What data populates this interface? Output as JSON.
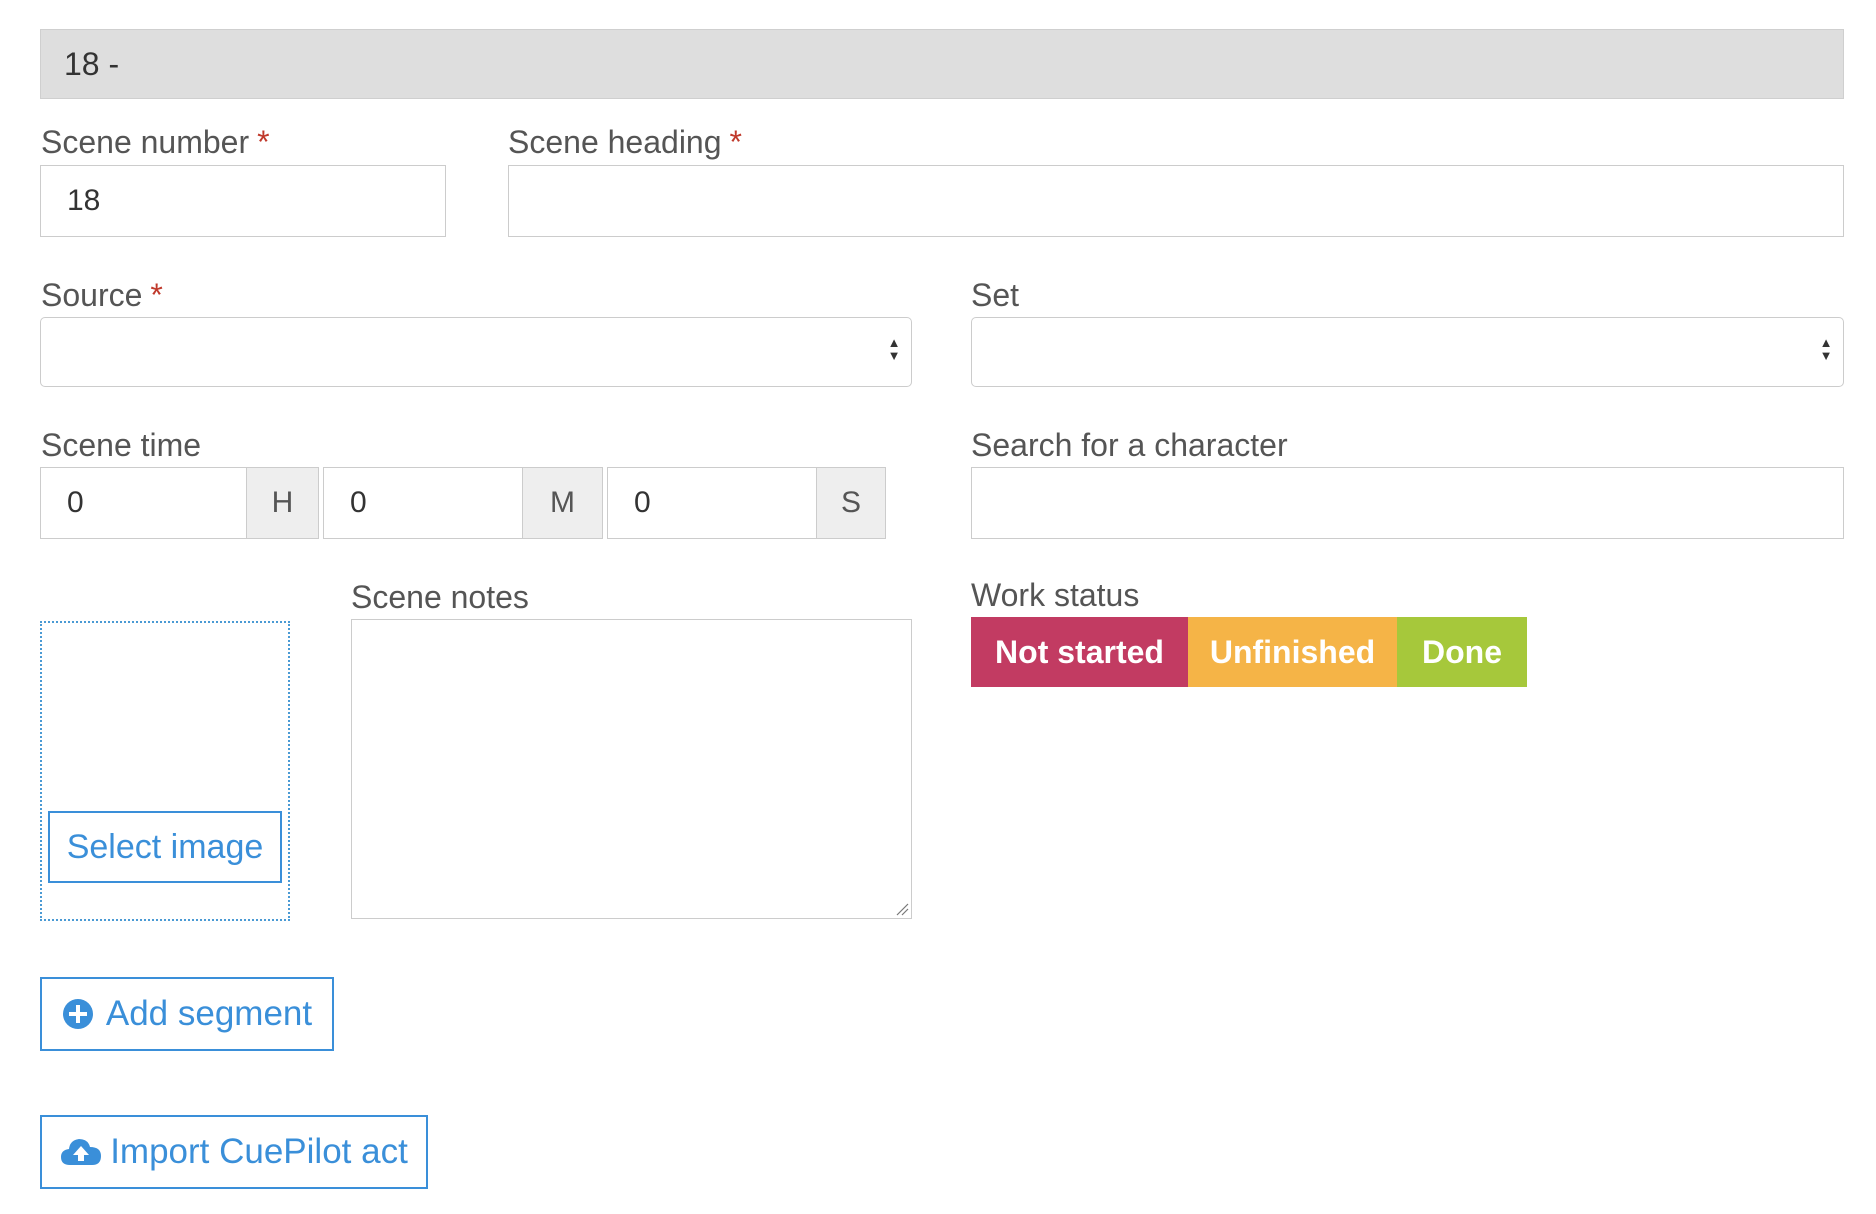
{
  "header": {
    "title": "18 -"
  },
  "fields": {
    "scene_number": {
      "label": "Scene number",
      "required_mark": "*",
      "value": "18"
    },
    "scene_heading": {
      "label": "Scene heading",
      "required_mark": "*",
      "value": ""
    },
    "source": {
      "label": "Source",
      "required_mark": "*",
      "selected": ""
    },
    "set": {
      "label": "Set",
      "selected": ""
    },
    "scene_time": {
      "label": "Scene time",
      "hours": "0",
      "hours_unit": "H",
      "minutes": "0",
      "minutes_unit": "M",
      "seconds": "0",
      "seconds_unit": "S"
    },
    "character_search": {
      "label": "Search for a character",
      "value": ""
    },
    "scene_notes": {
      "label": "Scene notes",
      "value": ""
    }
  },
  "image": {
    "select_label": "Select image"
  },
  "work_status": {
    "label": "Work status",
    "options": [
      {
        "label": "Not started",
        "color": "#c23b62"
      },
      {
        "label": "Unfinished",
        "color": "#f5b447"
      },
      {
        "label": "Done",
        "color": "#a6c83b"
      }
    ]
  },
  "actions": {
    "add_segment": {
      "label": "Add segment",
      "icon": "plus-circle-icon"
    },
    "import_cuepilot": {
      "label": "Import CuePilot act",
      "icon": "cloud-upload-icon"
    }
  },
  "colors": {
    "accent": "#3a8fd9",
    "required": "#c0392b"
  }
}
